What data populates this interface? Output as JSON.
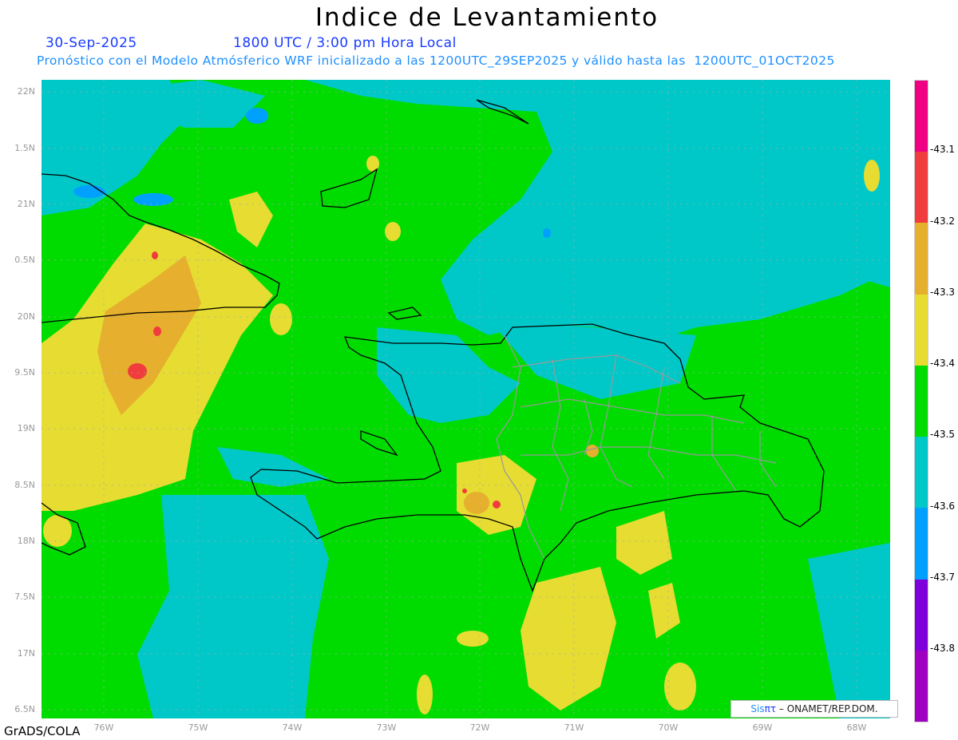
{
  "header": {
    "title": "Indice de Levantamiento",
    "date": "30-Sep-2025",
    "time": "1800 UTC / 3:00 pm Hora Local",
    "subtitle": "Pronóstico con el Modelo Atmósferico WRF inicializado a las 1200UTC_29SEP2025 y válido hasta las  1200UTC_01OCT2025"
  },
  "axes": {
    "lat_labels": [
      "22N",
      "1.5N",
      "21N",
      "0.5N",
      "20N",
      "9.5N",
      "19N",
      "8.5N",
      "18N",
      "7.5N",
      "17N",
      "6.5N"
    ],
    "lon_labels": [
      "76W",
      "75W",
      "74W",
      "73W",
      "72W",
      "71W",
      "70W",
      "69W",
      "68W"
    ]
  },
  "colorbar": {
    "labels": [
      "-43.1",
      "-43.2",
      "-43.3",
      "-43.4",
      "-43.5",
      "-43.6",
      "-43.7",
      "-43.8"
    ],
    "colors_top_to_bottom": [
      "#f00082",
      "#f03c3c",
      "#e6af2d",
      "#e6dc32",
      "#00dc00",
      "#00c8c8",
      "#00a0ff",
      "#8000dc",
      "#a000c0"
    ]
  },
  "footer": {
    "grads": "GrADS/COLA",
    "credit_sis": "Sis",
    "credit_pi": "πτ",
    "credit_rest": " – ONAMET/REP.DOM."
  }
}
